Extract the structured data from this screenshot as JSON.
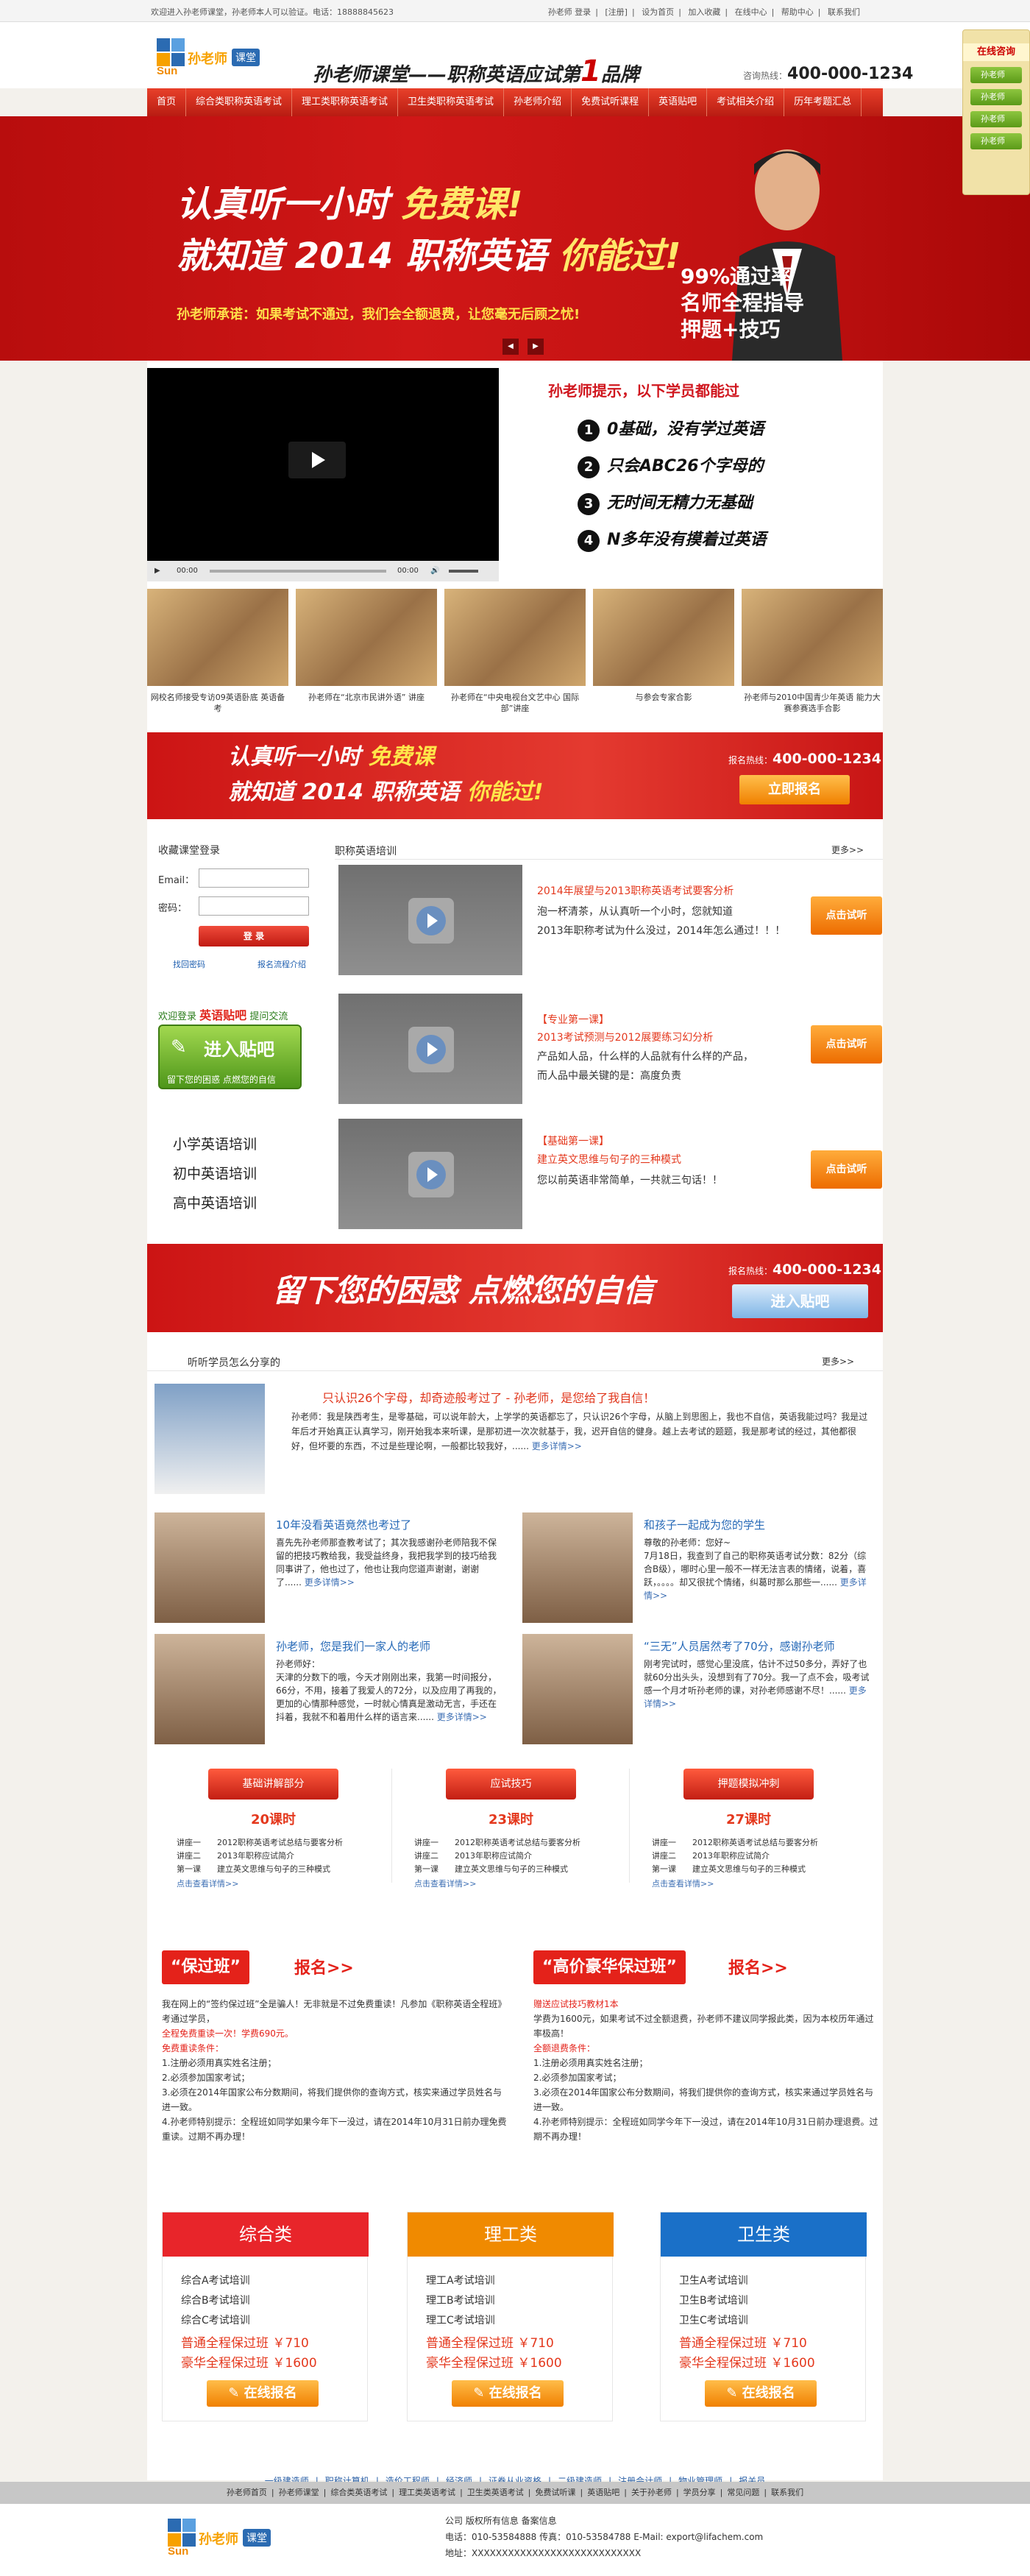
{
  "topbar": {
    "welcome": "欢迎进入孙老师课堂，孙老师本人可以验证。电话：18888845623",
    "links": [
      "孙老师 登录",
      "[注册]",
      "设为首页",
      "加入收藏",
      "在线中心",
      "帮助中心",
      "联系我们"
    ]
  },
  "header": {
    "logo": {
      "brand": "孙老师",
      "ke": "课堂",
      "sun": "Sun"
    },
    "slogan": "孙老师课堂——职称英语应试第",
    "slogan_num": "1",
    "slogan_tail": "品牌",
    "hotline_label": "咨询热线：",
    "hotline": "400-000-1234"
  },
  "nav": [
    "首页",
    "综合类职称英语考试",
    "理工类职称英语考试",
    "卫生类职称英语考试",
    "孙老师介绍",
    "免费试听课程",
    "英语贴吧",
    "考试相关介绍",
    "历年考题汇总"
  ],
  "banner": {
    "line1_a": "认真听一小时",
    "line1_b": "免费课!",
    "line2_a": "就知道 2014 职称英语",
    "line2_b": "你能过!",
    "promise": "孙老师承诺：如果考试不通过，我们会全额退费，让您毫无后顾之忧!",
    "bullet1": "99%通过率",
    "bullet2": "名师全程指导",
    "bullet3": "押题+技巧"
  },
  "side_chat": {
    "title": "在线咨询",
    "buttons": [
      "孙老师",
      "孙老师",
      "孙老师",
      "孙老师"
    ]
  },
  "video": {
    "time_start": "00:00",
    "time_end": "00:00"
  },
  "learn": {
    "heading": "孙老师提示，以下学员都能过",
    "items": [
      {
        "n": "1",
        "text": "0基础，没有学过英语"
      },
      {
        "n": "2",
        "text": "只会ABC26个字母的"
      },
      {
        "n": "3",
        "text": "无时间无精力无基础"
      },
      {
        "n": "4",
        "text": "N多年没有摸着过英语"
      }
    ]
  },
  "photos": [
    {
      "caption": "网校名师接受专访09英语卧底\n英语备考"
    },
    {
      "caption": "孙老师在“北京市民讲外语”\n讲座"
    },
    {
      "caption": "孙老师在“中央电视台文艺中心\n国际部”讲座"
    },
    {
      "caption": "与参会专家合影"
    },
    {
      "caption": "孙老师与2010中国青少年英语\n能力大赛参赛选手合影"
    }
  ],
  "cta1": {
    "line1": "认真听一小时",
    "line1_b": "免费课",
    "line2": "就知道 2014 职称英语",
    "line2_b": "你能过!",
    "phone_label": "报名热线：",
    "phone": "400-000-1234",
    "button": "立即报名"
  },
  "login": {
    "title": "收藏课堂登录",
    "email_label": "Email：",
    "password_label": "密码：",
    "button": "登 录",
    "forgot": "找回密码",
    "process": "报名流程介绍"
  },
  "forum": {
    "title_a": "欢迎登录",
    "title_b": "英语贴吧",
    "title_c": "提问交流",
    "button": "进入贴吧",
    "sub": "留下您的困惑  点燃您的自信"
  },
  "training": [
    "小学英语培训",
    "初中英语培训",
    "高中英语培训"
  ],
  "courses": {
    "heading": "职称英语培训",
    "more": "更多>>",
    "items": [
      {
        "title": "2014年展望与2013职称英语考试要客分析",
        "l1": "泡一杯清茶，从认真听一个小时，您就知道",
        "l2": "2013年职称考试为什么没过，2014年怎么通过！！！",
        "btn": "点击试听"
      },
      {
        "title": "【专业第一课】",
        "subtitle": "2013考试预测与2012展要练习幻分析",
        "l1": "产品如人品，什么样的人品就有什么样的产品，",
        "l2": "而人品中最关键的是：高度负责",
        "btn": "点击试听"
      },
      {
        "title": "【基础第一课】",
        "subtitle": "建立英文思维与句子的三种模式",
        "l1": "您以前英语非常简单，一共就三句话！！",
        "btn": "点击试听"
      }
    ]
  },
  "cta2": {
    "text": "留下您的困惑 点燃您的自信",
    "phone_label": "报名热线：",
    "phone": "400-000-1234",
    "button": "进入贴吧"
  },
  "shares": {
    "heading": "听听学员怎么分享的",
    "more": "更多>>",
    "featured": {
      "title": "只认识26个字母，却奇迹般考过了 - 孙老师，是您给了我自信！",
      "text": "孙老师：我是陕西考生，是零基础，可以说年龄大，上学学的英语都忘了，只认识26个字母，从脑上到思图上，我也不自信，英语我能过吗？我是过年后才开始真正认真学习，刚开始我本来听课，是那初进一次次就基于，我，迟开自信的健身。越上去考试的题题，我是那考试的经过，其他都很好，但坏要的东西，不过是些理论啊，一般都比较我好，......",
      "more": "更多详情>>"
    },
    "items": [
      {
        "title": "10年没看英语竟然也考过了",
        "text": "喜先先孙老师那查教考试了；其次我感谢孙老师陪我不保留的把技巧教给我，我受益终身，我把我学到的技巧给我同事讲了，他也过了，他也让我向您道声谢谢，谢谢了......",
        "more": "更多详情>>"
      },
      {
        "title": "和孩子一起成为您的学生",
        "text": "尊敬的孙老师：您好~\n7月18日，我查到了自己的职称英语考试分数：82分（综合B级），哪时心里一般不一样无法言表的情绪，说着，喜跃，。。。。却又很扰个情绪，纠葛时那么那些一......",
        "more": "更多详情>>"
      },
      {
        "title": "孙老师，您是我们一家人的老师",
        "text": "孙老师好：\n天津的分数下的哦，今天才刚刚出来，我第一时间报分，66分，不用，接着了我爱人的72分，以及应用了再我的，更加的心情那种感觉，一时就心情真是激动无言，手还在抖着，我就不和着用什么样的语言来......",
        "more": "更多详情>>"
      },
      {
        "title": "“三无”人员居然考了70分，感谢孙老师",
        "text": "刚考完试时，感觉心里没底，估计不过50多分，弄好了也就60分出头头，没想到有了70分。我一了点不会，吸考试感一个月才听孙老师的课，对孙老师感谢不尽！......",
        "more": "更多详情>>"
      }
    ]
  },
  "packages": [
    {
      "ribbon": "基础讲解部分",
      "hours": "20课时",
      "lines": [
        "讲座一　　2012职称英语考试总结与要客分析",
        "讲座二　　2013年职称应试简介",
        "第一课　　建立英文思维与句子的三种模式"
      ],
      "more": "点击查看详情>>"
    },
    {
      "ribbon": "应试技巧",
      "hours": "23课时",
      "lines": [
        "讲座一　　2012职称英语考试总结与要客分析",
        "讲座二　　2013年职称应试简介",
        "第一课　　建立英文思维与句子的三种模式"
      ],
      "more": "点击查看详情>>"
    },
    {
      "ribbon": "押题模拟冲刺",
      "hours": "27课时",
      "lines": [
        "讲座一　　2012职称英语考试总结与要客分析",
        "讲座二　　2013年职称应试简介",
        "第一课　　建立英文思维与句子的三种模式"
      ],
      "more": "点击查看详情>>"
    }
  ],
  "signups": [
    {
      "tag": "“保过班”",
      "reg": "报名>>",
      "lines": [
        "我在网上的“签约保过班”全是骗人！无非就是不过免费重读！凡参加《职称英语全程班》考通过学员，",
        "全程免费重读一次！学费690元。",
        "免费重读条件：",
        "1.注册必须用真实姓名注册；",
        "2.必须参加国家考试；",
        "3.必须在2014年国家公布分数期间，将我们提供你的查询方式，核实来通过学员姓名与进一致。",
        "4.孙老师特别提示：全程班如同学如果今年下一没过，请在2014年10月31日前办理免费重读。过期不再办理！"
      ]
    },
    {
      "tag": "“高价豪华保过班”",
      "reg": "报名>>",
      "lines": [
        "赠送应试技巧教材1本",
        "学费为1600元，如果考试不过全额退费，孙老师不建议同学报此类，因为本校历年通过率极高！",
        "全额退费条件：",
        "1.注册必须用真实姓名注册；",
        "2.必须参加国家考试；",
        "3.必须在2014年国家公布分数期间，将我们提供你的查询方式，核实来通过学员姓名与进一致。",
        "4.孙老师特别提示：全程班如同学今年下一没过，请在2014年10月31日前办理退费。过期不再办理！"
      ]
    }
  ],
  "categories": [
    {
      "name": "综合类",
      "color": "#e8252a",
      "lines": [
        "综合A考试培训",
        "综合B考试培训",
        "综合C考试培训"
      ],
      "p1": "普通全程保过班  ￥710",
      "p2": "豪华全程保过班  ￥1600",
      "btn": "在线报名"
    },
    {
      "name": "理工类",
      "color": "#f08a00",
      "lines": [
        "理工A考试培训",
        "理工B考试培训",
        "理工C考试培训"
      ],
      "p1": "普通全程保过班  ￥710",
      "p2": "豪华全程保过班  ￥1600",
      "btn": "在线报名"
    },
    {
      "name": "卫生类",
      "color": "#1a70c8",
      "lines": [
        "卫生A考试培训",
        "卫生B考试培训",
        "卫生C考试培训"
      ],
      "p1": "普通全程保过班  ￥710",
      "p2": "豪华全程保过班  ￥1600",
      "btn": "在线报名"
    }
  ],
  "linkrow": [
    "一级建造师",
    "职称计算机",
    "造价工程师",
    "经济师",
    "证券从业资格",
    "二级建造师",
    "注册会计师",
    "物业管理师",
    "报关员"
  ],
  "footnav": [
    "孙老师首页",
    "孙老师课堂",
    "综合类英语考试",
    "理工类英语考试",
    "卫生类英语考试",
    "免费试听课",
    "英语贴吧",
    "关于孙老师",
    "学员分享",
    "常见问题",
    "联系我们"
  ],
  "footer": {
    "company": "公司   版权所有信息   备案信息",
    "phone": "电话：010-53584888   传真：010-53584788   E-Mail: export@lifachem.com",
    "address": "地址：XXXXXXXXXXXXXXXXXXXXXXXXXXXX"
  }
}
